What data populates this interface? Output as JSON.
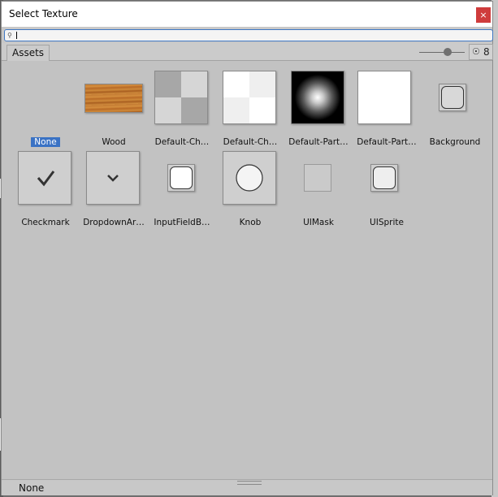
{
  "window": {
    "title": "Select Texture",
    "close_glyph": "×"
  },
  "search": {
    "value": "",
    "placeholder": "",
    "icon": "search-icon"
  },
  "toolbar": {
    "tab_label": "Assets",
    "slider_level": 0.62,
    "hidden_count": "8",
    "hidden_icon": "eye-slash-icon"
  },
  "assets": [
    {
      "name": "None",
      "selected": true,
      "kind": "none"
    },
    {
      "name": "Wood",
      "kind": "wood"
    },
    {
      "name": "Default-Ch…",
      "kind": "checker-gray"
    },
    {
      "name": "Default-Ch…",
      "kind": "checker-white"
    },
    {
      "name": "Default-Part…",
      "kind": "particle"
    },
    {
      "name": "Default-Part…",
      "kind": "white"
    },
    {
      "name": "Background",
      "kind": "rounded-box"
    },
    {
      "name": "Checkmark",
      "kind": "checkmark"
    },
    {
      "name": "DropdownAr…",
      "kind": "dropdown-arrow"
    },
    {
      "name": "InputFieldB…",
      "kind": "rounded-box-white"
    },
    {
      "name": "Knob",
      "kind": "knob"
    },
    {
      "name": "UIMask",
      "kind": "square"
    },
    {
      "name": "UISprite",
      "kind": "rounded-box-light"
    }
  ],
  "footer": {
    "status": "None"
  },
  "colors": {
    "accent": "#3a72c4",
    "close": "#cf3c3c",
    "panel": "#c2c2c2"
  }
}
